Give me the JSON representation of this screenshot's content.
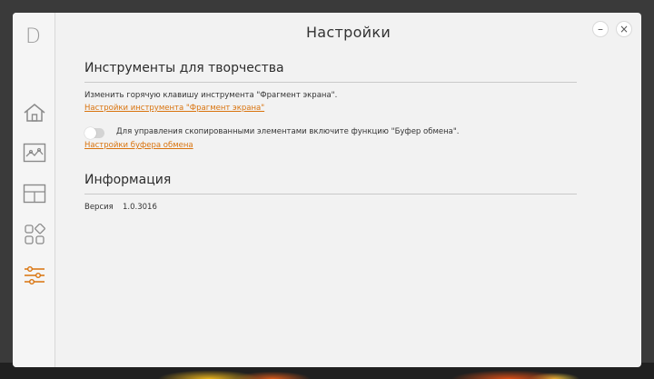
{
  "app": {
    "logo_letter": "D"
  },
  "window": {
    "title": "Настройки",
    "minimize_symbol": "–",
    "close_symbol": "×"
  },
  "sidebar": {
    "items": [
      {
        "name": "home",
        "icon": "home-icon"
      },
      {
        "name": "image",
        "icon": "picture-icon"
      },
      {
        "name": "layout",
        "icon": "layout-icon"
      },
      {
        "name": "apps",
        "icon": "apps-icon"
      },
      {
        "name": "settings",
        "icon": "sliders-icon",
        "active": true
      }
    ]
  },
  "creative_tools": {
    "heading": "Инструменты для творчества",
    "hotkey_text": "Изменить горячую клавишу инструмента \"Фрагмент экрана\".",
    "snip_settings_link": "Настройки инструмента \"Фрагмент экрана\"",
    "clipboard_text": "Для управления скопированными элементами включите функцию \"Буфер обмена\".",
    "clipboard_settings_link": "Настройки буфера обмена",
    "clipboard_enabled": false
  },
  "info": {
    "heading": "Информация",
    "version_label": "Версия",
    "version_value": "1.0.3016"
  },
  "colors": {
    "accent": "#d9730d",
    "text": "#333333",
    "window_bg": "#f2f2f2"
  }
}
